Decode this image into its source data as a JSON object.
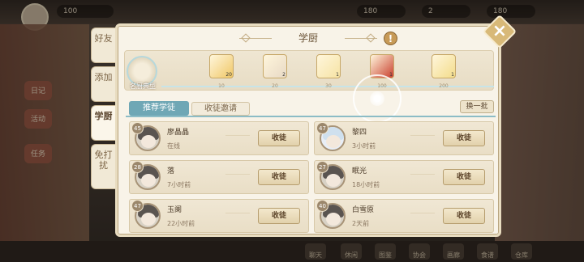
{
  "background": {
    "resources": [
      "100",
      "180",
      "2",
      "180"
    ],
    "side_menu": [
      "日记",
      "活动",
      "任务"
    ],
    "nav": [
      "聊天",
      "休闲",
      "图鉴",
      "协会",
      "画廊",
      "食谱",
      "仓库"
    ]
  },
  "side_tabs": [
    {
      "label": "好友"
    },
    {
      "label": "添加"
    },
    {
      "label": "学厨"
    },
    {
      "label": "免打扰"
    }
  ],
  "panel": {
    "title": "学厨",
    "warn_icon": "!",
    "close_icon": "×"
  },
  "track": {
    "role_label": "名厨典型",
    "rewards": [
      {
        "count": "20",
        "value": "10",
        "color": "#f0c766"
      },
      {
        "count": "2",
        "value": "20",
        "color": "#e8d9c5"
      },
      {
        "count": "1",
        "value": "30",
        "color": "#f6e3a4"
      },
      {
        "count": "1",
        "value": "100",
        "color": "#c9402e"
      },
      {
        "count": "1",
        "value": "200",
        "color": "#f3dc8a"
      }
    ]
  },
  "tabs": {
    "recommend": "推荐学徒",
    "invite": "收徒邀请",
    "refresh": "换一批"
  },
  "apprentices": [
    {
      "level": "45",
      "name": "廖晶晶",
      "status": "在线",
      "button": "收徒"
    },
    {
      "level": "47",
      "name": "黎四",
      "status": "3小时前",
      "button": "收徒"
    },
    {
      "level": "28",
      "name": "落",
      "status": "7小时前",
      "button": "收徒"
    },
    {
      "level": "27",
      "name": "眠光",
      "status": "18小时前",
      "button": "收徒"
    },
    {
      "level": "47",
      "name": "玉阑",
      "status": "22小时前",
      "button": "收徒"
    },
    {
      "level": "40",
      "name": "白雪原",
      "status": "2天前",
      "button": "收徒"
    }
  ]
}
